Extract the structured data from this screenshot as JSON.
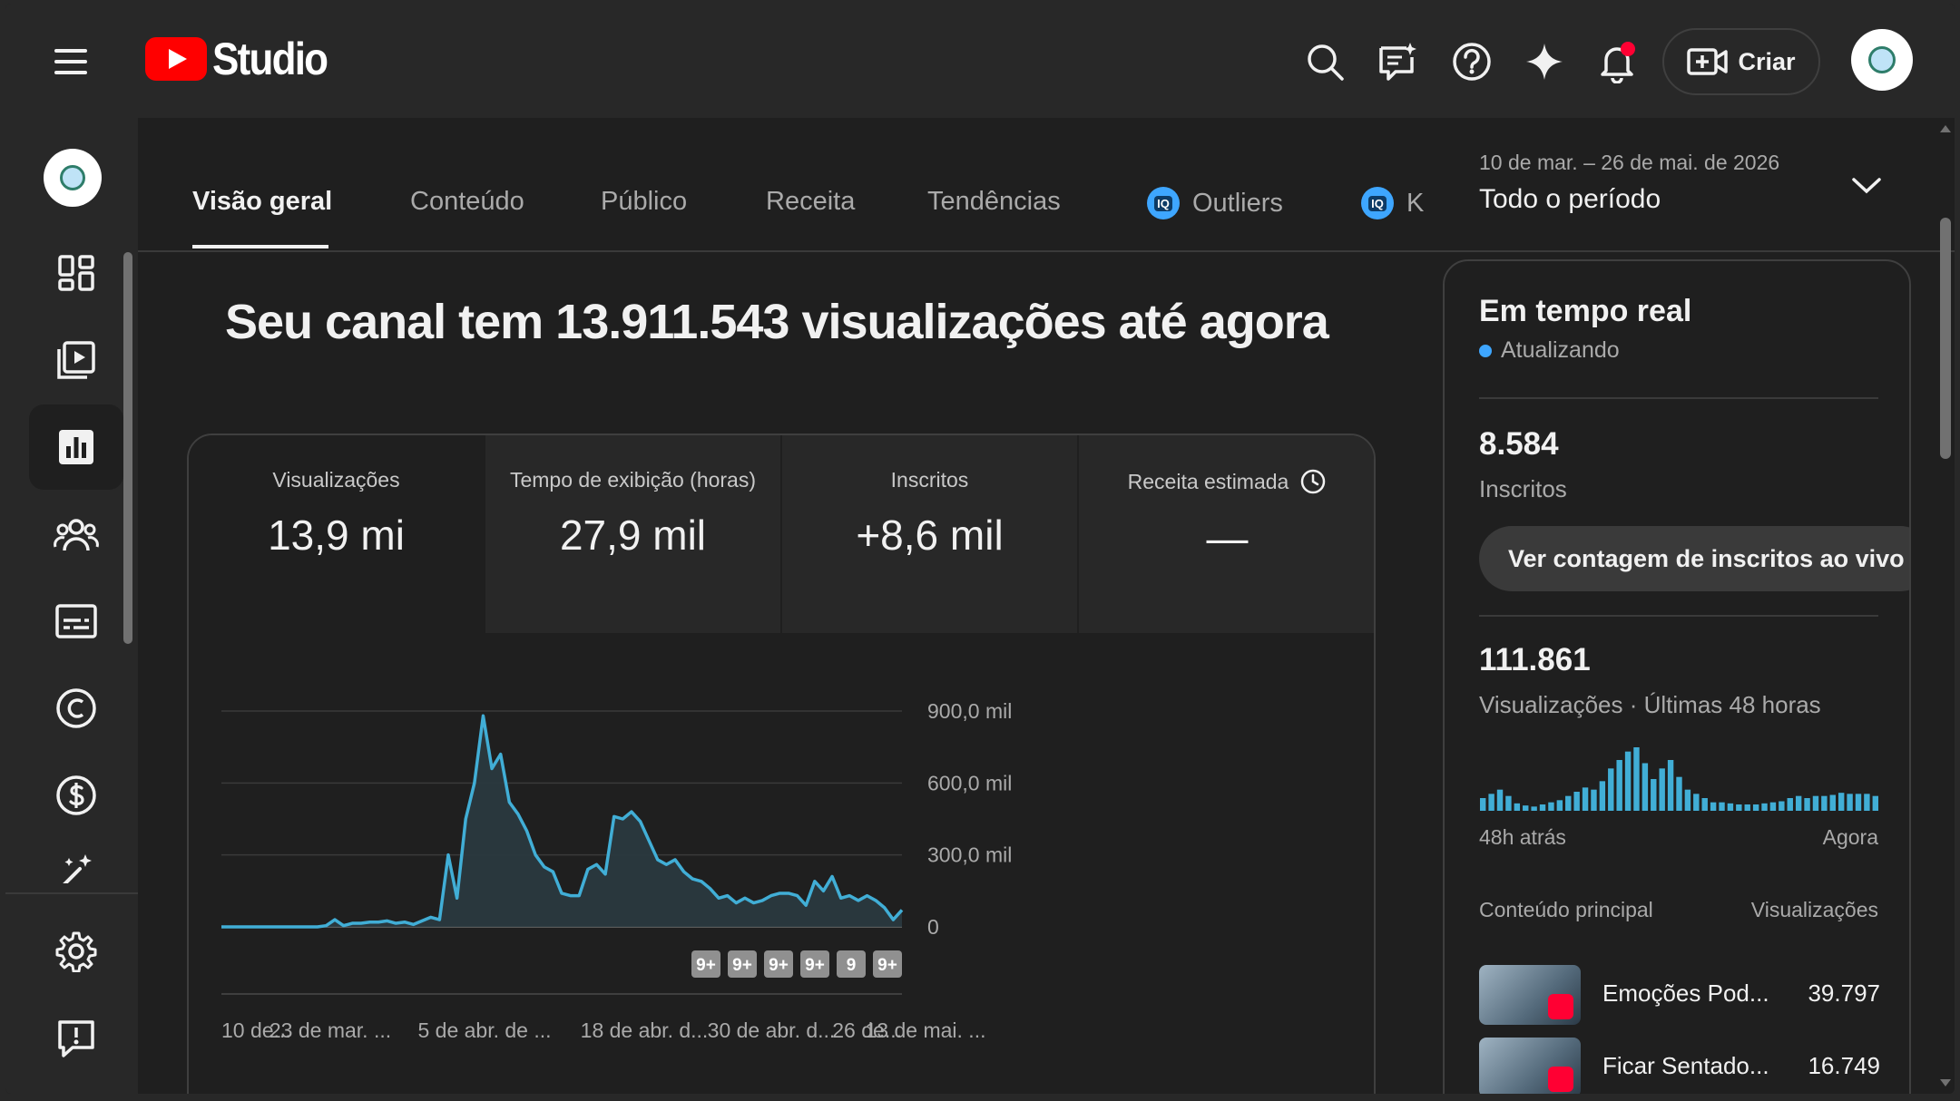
{
  "header": {
    "logo_text": "Studio",
    "create_label": "Criar",
    "icons": [
      "menu-icon",
      "search-icon",
      "feedback-icon",
      "help-icon",
      "sparkle-icon",
      "notifications-icon"
    ]
  },
  "sidebar": {
    "items": [
      "dashboard-icon",
      "content-icon",
      "analytics-icon",
      "community-icon",
      "subtitles-icon",
      "copyright-icon",
      "earn-icon",
      "customization-icon",
      "settings-icon",
      "send-feedback-icon"
    ],
    "active": "analytics-icon"
  },
  "tabs": {
    "items": [
      {
        "label": "Visão geral",
        "active": true
      },
      {
        "label": "Conteúdo"
      },
      {
        "label": "Público"
      },
      {
        "label": "Receita"
      },
      {
        "label": "Tendências"
      },
      {
        "label": "Outliers",
        "badge": "IQ"
      },
      {
        "label": "K",
        "badge": "IQ"
      }
    ],
    "badge_text": "IQ"
  },
  "date_range": {
    "range": "10 de mar. – 26 de mai. de 2026",
    "period": "Todo o período"
  },
  "headline": "Seu canal tem 13.911.543 visualizações até agora",
  "metrics": [
    {
      "label": "Visualizações",
      "value": "13,9 mi"
    },
    {
      "label": "Tempo de exibição (horas)",
      "value": "27,9 mil"
    },
    {
      "label": "Inscritos",
      "value": "+8,6 mil"
    },
    {
      "label": "Receita estimada",
      "value": "—"
    }
  ],
  "chart_data": {
    "type": "area",
    "series": [
      {
        "values": [
          0,
          0,
          0,
          0,
          0,
          0,
          0,
          0,
          0,
          0,
          0,
          0,
          5000,
          30000,
          5000,
          15000,
          15000,
          20000,
          20000,
          25000,
          15000,
          20000,
          10000,
          25000,
          40000,
          30000,
          300000,
          120000,
          450000,
          600000,
          880000,
          660000,
          720000,
          520000,
          470000,
          400000,
          300000,
          250000,
          230000,
          140000,
          130000,
          130000,
          240000,
          260000,
          220000,
          460000,
          450000,
          480000,
          440000,
          360000,
          280000,
          260000,
          280000,
          230000,
          200000,
          190000,
          160000,
          120000,
          130000,
          100000,
          120000,
          100000,
          110000,
          130000,
          140000,
          140000,
          130000,
          90000,
          190000,
          150000,
          210000,
          120000,
          130000,
          110000,
          130000,
          110000,
          80000,
          30000,
          70000
        ]
      }
    ],
    "ylim": [
      0,
      900000
    ],
    "y_ticks": [
      "900,0 mil",
      "600,0 mil",
      "300,0 mil",
      "0"
    ],
    "x_ticks": [
      "10 de...",
      "23 de mar. ...",
      "5 de abr. de ...",
      "18 de abr. d...",
      "30 de abr. d...",
      "13 de mai. ...",
      "26 de..."
    ],
    "badges": [
      "9+",
      "9+",
      "9+",
      "9+",
      "9",
      "9+"
    ]
  },
  "colors": {
    "accent": "#3ea6ff",
    "line": "#41aed6",
    "fill": "#2a3a40"
  },
  "realtime": {
    "title": "Em tempo real",
    "status": "Atualizando",
    "subs_value": "8.584",
    "subs_label": "Inscritos",
    "live_button": "Ver contagem de inscritos ao vivo",
    "views_value": "111.861",
    "views_label": "Visualizações · Últimas 48 horas",
    "bars": [
      12,
      16,
      20,
      14,
      7,
      5,
      4,
      6,
      8,
      10,
      14,
      18,
      22,
      20,
      28,
      40,
      48,
      56,
      60,
      45,
      30,
      40,
      48,
      32,
      20,
      16,
      12,
      8,
      8,
      7,
      6,
      6,
      6,
      7,
      8,
      9,
      12,
      14,
      12,
      14,
      14,
      15,
      17,
      16,
      16,
      16,
      14
    ],
    "bars_start": "48h atrás",
    "bars_end": "Agora",
    "table_head_left": "Conteúdo principal",
    "table_head_right": "Visualizações",
    "top_content": [
      {
        "title": "Emoções Pod...",
        "views": "39.797"
      },
      {
        "title": "Ficar Sentado...",
        "views": "16.749"
      }
    ]
  }
}
